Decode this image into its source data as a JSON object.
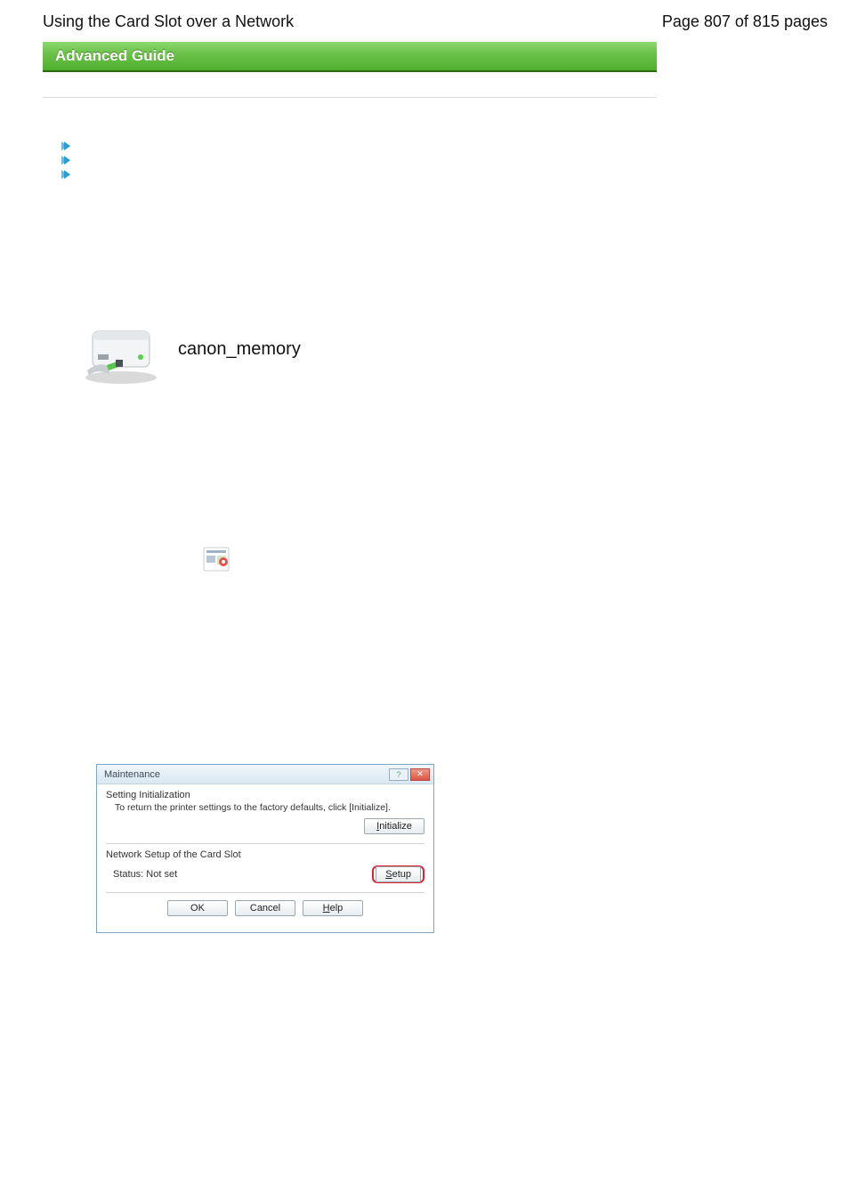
{
  "header": {
    "title": "Using the Card Slot over a Network",
    "page_label": "Page 807 of 815 pages"
  },
  "banner": {
    "text": "Advanced Guide"
  },
  "links": {
    "items": [
      {
        "label": ""
      },
      {
        "label": ""
      },
      {
        "label": ""
      }
    ]
  },
  "drive": {
    "label": "canon_memory"
  },
  "dialog": {
    "title": "Maintenance",
    "section1_title": "Setting Initialization",
    "section1_desc": "To return the printer settings to the factory defaults, click [Initialize].",
    "initialize_btn": "Initialize",
    "section2_title": "Network Setup of the Card Slot",
    "status_label": "Status: Not set",
    "setup_btn": "Setup",
    "ok_btn": "OK",
    "cancel_btn": "Cancel",
    "help_btn": "Help"
  }
}
